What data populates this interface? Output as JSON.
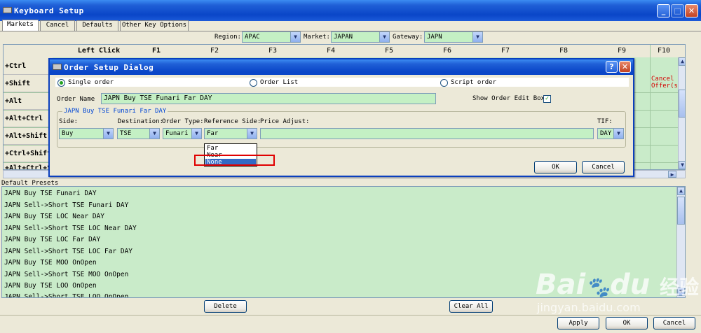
{
  "window": {
    "title": "Keyboard Setup"
  },
  "tabs": [
    "Markets",
    "Cancel",
    "Defaults",
    "Other Key Options"
  ],
  "filters": {
    "region_label": "Region:",
    "region_value": "APAC",
    "market_label": "Market:",
    "market_value": "JAPAN",
    "gateway_label": "Gateway:",
    "gateway_value": "JAPN"
  },
  "grid": {
    "columns": [
      "Left Click",
      "F1",
      "F2",
      "F3",
      "F4",
      "F5",
      "F6",
      "F7",
      "F8",
      "F9",
      "F10"
    ],
    "rows": [
      "+Ctrl",
      "+Shift",
      "+Alt",
      "+Alt+Ctrl",
      "+Alt+Shift",
      "+Ctrl+Shift",
      "+Alt+Ctrl+Shift"
    ],
    "red_cell_line1": "Cancel Old",
    "red_cell_line2": "Offer(s)"
  },
  "dialog": {
    "title": "Order Setup Dialog",
    "help_glyph": "?",
    "radio_single": "Single order",
    "radio_list": "Order List",
    "radio_script": "Script order",
    "order_name_label": "Order Name",
    "order_name_value": "JAPN Buy TSE Funari Far DAY",
    "show_edit_label": "Show Order Edit Box",
    "group_title": "JAPN Buy TSE Funari Far DAY",
    "side_label": "Side:",
    "side_value": "Buy",
    "dest_label": "Destination:",
    "dest_value": "TSE",
    "type_label": "Order Type:",
    "type_value": "Funari",
    "refside_label": "Reference Side:",
    "refside_value": "Far",
    "price_label": "Price Adjust:",
    "tif_label": "TIF:",
    "tif_value": "DAY",
    "refside_options": [
      "Far",
      "Near",
      "None"
    ],
    "ok": "OK",
    "cancel": "Cancel"
  },
  "presets": {
    "title": "Default Presets",
    "items": [
      "JAPN Buy TSE Funari DAY",
      "JAPN Sell->Short TSE Funari DAY",
      "JAPN Buy TSE LOC Near DAY",
      "JAPN Sell->Short TSE LOC Near DAY",
      "JAPN Buy TSE LOC Far DAY",
      "JAPN Sell->Short TSE LOC Far DAY",
      "JAPN Buy TSE MOO OnOpen",
      "JAPN Sell->Short TSE MOO OnOpen",
      "JAPN Buy TSE LOO OnOpen",
      "JAPN Sell->Short TSE LOO OnOpen"
    ],
    "delete": "Delete",
    "clear_all": "Clear  All"
  },
  "footer": {
    "apply": "Apply",
    "ok": "OK",
    "cancel": "Cancel"
  },
  "watermark": {
    "brand": "Bai",
    "brand2": "du",
    "cn": "经验",
    "url": "jingyan.baidu.com"
  },
  "colors": {
    "cell_green": "#c9ebc9",
    "field_green": "#c4f0c4",
    "highlight_red": "#e00000",
    "selection_blue": "#316ac5"
  }
}
